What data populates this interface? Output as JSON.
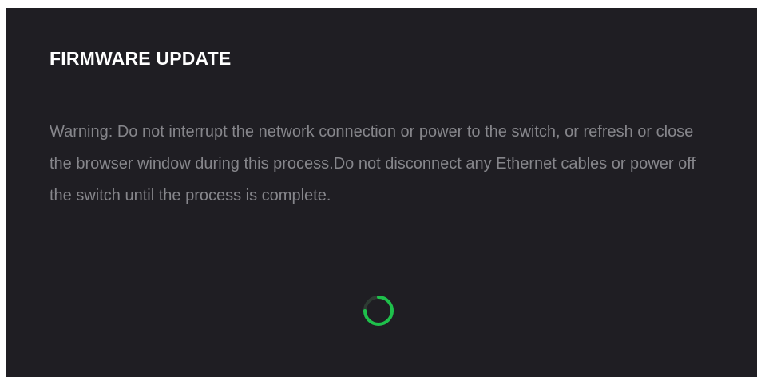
{
  "dialog": {
    "title": "FIRMWARE UPDATE",
    "warning": "Warning: Do not interrupt the network connection or power to the switch, or refresh or close the browser window during this process.Do not disconnect any Ethernet cables or power off the switch until the process is complete."
  },
  "spinner": {
    "icon": "loading-spinner-icon",
    "color": "#1ec04b",
    "track_color": "#2e3b33"
  },
  "colors": {
    "background": "#1f1e23",
    "title": "#ffffff",
    "text": "#86868b"
  }
}
